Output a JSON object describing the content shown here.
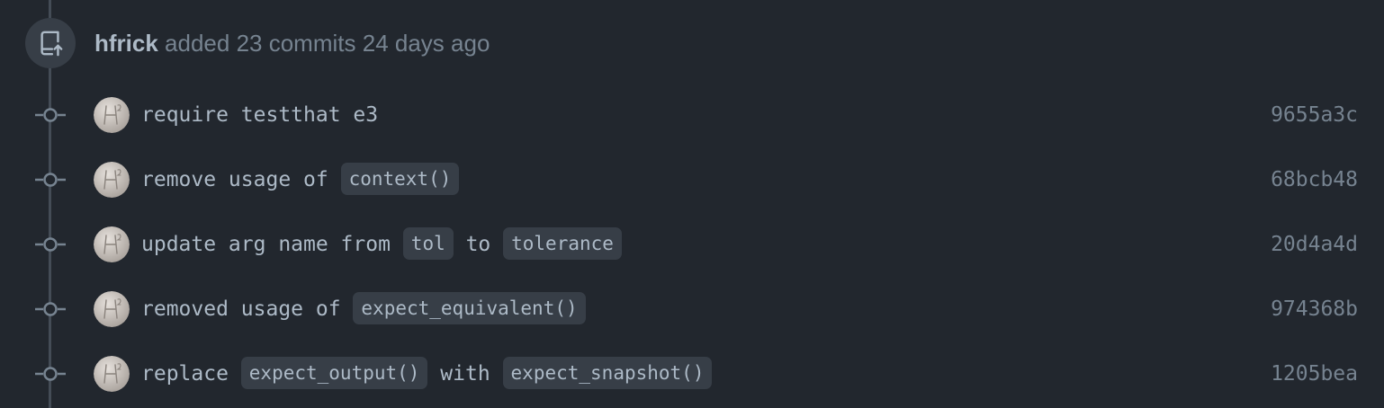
{
  "event": {
    "icon": "repo-push-icon",
    "author": "hfrick",
    "action": "added 23 commits",
    "time": "24 days ago"
  },
  "commits": [
    {
      "parts": [
        "require testthat e3"
      ],
      "sha": "9655a3c"
    },
    {
      "parts": [
        "remove usage of ",
        "context()"
      ],
      "sha": "68bcb48"
    },
    {
      "parts": [
        "update arg name from ",
        "tol",
        " to ",
        "tolerance"
      ],
      "sha": "20d4a4d"
    },
    {
      "parts": [
        "removed usage of ",
        "expect_equivalent()"
      ],
      "sha": "974368b"
    },
    {
      "parts": [
        "replace ",
        "expect_output()",
        " with ",
        "expect_snapshot()"
      ],
      "sha": "1205bea"
    }
  ],
  "colors": {
    "background": "#22272e",
    "timeline": "#444c56",
    "code_bg": "#373e47",
    "text": "#adbac7",
    "muted": "#768390"
  }
}
